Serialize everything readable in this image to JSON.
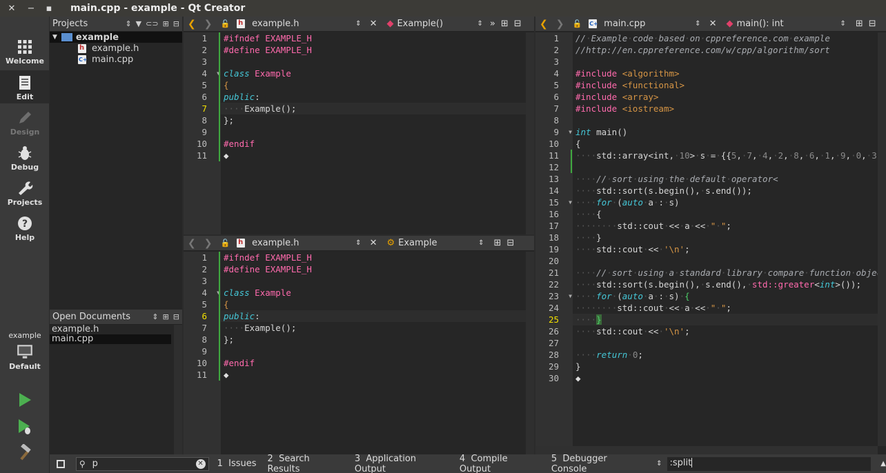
{
  "window": {
    "title": "main.cpp - example - Qt Creator",
    "close": "✕",
    "minimize": "−",
    "maximize": "▪"
  },
  "modes": [
    {
      "label": "Welcome",
      "icon": "grid-icon",
      "state": "normal"
    },
    {
      "label": "Edit",
      "icon": "document-icon",
      "state": "active"
    },
    {
      "label": "Design",
      "icon": "pencil-icon",
      "state": "disabled"
    },
    {
      "label": "Debug",
      "icon": "bug-icon",
      "state": "normal"
    },
    {
      "label": "Projects",
      "icon": "wrench-icon",
      "state": "normal"
    },
    {
      "label": "Help",
      "icon": "help-icon",
      "state": "normal"
    }
  ],
  "target": {
    "project": "example",
    "config": "Default"
  },
  "projects": {
    "header": "Projects",
    "root": "example",
    "files": [
      "example.h",
      "main.cpp"
    ]
  },
  "open_documents": {
    "header": "Open Documents",
    "items": [
      "example.h",
      "main.cpp"
    ],
    "selected": 1
  },
  "editors": [
    {
      "file": "example.h",
      "symbol": "Example()",
      "symbol_icon": "method-icon",
      "current_line": 7,
      "lines": 11
    },
    {
      "file": "example.h",
      "symbol": "Example",
      "symbol_icon": "class-icon",
      "current_line": 6,
      "lines": 11
    },
    {
      "file": "main.cpp",
      "symbol": "main(): int",
      "symbol_icon": "method-icon",
      "current_line": 25,
      "lines": 30
    }
  ],
  "locator": {
    "value": "p",
    "icon": "search-icon"
  },
  "output_tabs": [
    {
      "num": "1",
      "label": "Issues"
    },
    {
      "num": "2",
      "label": "Search Results"
    },
    {
      "num": "3",
      "label": "Application Output"
    },
    {
      "num": "4",
      "label": "Compile Output"
    },
    {
      "num": "5",
      "label": "Debugger Console"
    }
  ],
  "command": {
    "value": ":split"
  },
  "colors": {
    "background": "#262626",
    "gutter": "#313131",
    "keyword": "#45c6d6",
    "preprocessor": "#ff6aad",
    "string": "#d69545",
    "current_line_number": "#f2e000",
    "changed_line_marker": "#3fa83f"
  }
}
